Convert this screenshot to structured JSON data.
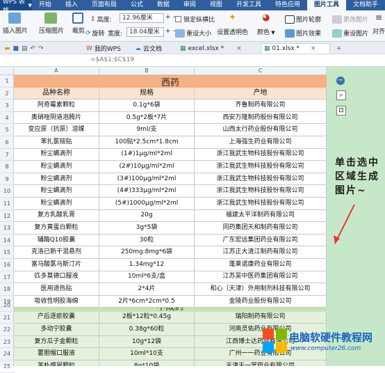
{
  "app": {
    "title": "WPS 表格"
  },
  "ribbon_tabs": [
    "开始",
    "插入",
    "页面布局",
    "公式",
    "数据",
    "审阅",
    "视图",
    "开发工具",
    "特色应用",
    "图片工具",
    "文档助手"
  ],
  "active_tab": "图片工具",
  "ribbon": {
    "insert_picture": "插入图片",
    "compress_picture": "压缩图片",
    "crop": "裁剪",
    "rotate": "旋转",
    "height_label": "高度:",
    "height_value": "12.96厘米",
    "width_label": "宽度:",
    "width_value": "18.04厘米",
    "lock_ratio": "锁定纵横比",
    "reset_size": "重设大小",
    "set_transparent": "设置透明色",
    "color": "颜色",
    "picture_outline": "图片轮廓",
    "picture_effect": "图片效果",
    "change_picture": "更改图片",
    "reset_picture": "重设图片",
    "align": "对齐"
  },
  "doc_tabs": [
    "我的WPS",
    "云文档",
    "excel.xlsx *",
    "01.xlsx *"
  ],
  "active_doc": "01.xlsx *",
  "formula_bar": {
    "formula": "=$A$1:$C$19"
  },
  "columns": [
    "A",
    "B",
    "C"
  ],
  "rows": [
    "1",
    "2",
    "3",
    "4",
    "5",
    "6",
    "7",
    "8",
    "9",
    "10",
    "11",
    "12",
    "13",
    "14",
    "15",
    "16",
    "17",
    "18",
    "19",
    "20",
    "21",
    "22",
    "23",
    "24",
    "25"
  ],
  "section1": {
    "title": "西药",
    "header": [
      "品种名称",
      "规格",
      "产地"
    ]
  },
  "table1": [
    [
      "阿奇霉素颗粒",
      "0.1g*6袋",
      "齐鲁制药有限公司"
    ],
    [
      "奥硝唑阴道泡腾片",
      "0.5g*2板*7片",
      "西安万隆制药股份有限公司"
    ],
    [
      "变应原（抗原）溶媒",
      "9ml/支",
      "山西太行药业股份有限公司"
    ],
    [
      "苯扎氯铵贴",
      "100贴*2.5cm*1.8cm",
      "上海强生药业有限公司"
    ],
    [
      "粉尘螨滴剂",
      "(1#)1μg/ml*2ml",
      "浙江我武生物科技股份有限公司"
    ],
    [
      "粉尘螨滴剂",
      "(2#)10μg/ml*2ml",
      "浙江我武生物科技股份有限公司"
    ],
    [
      "粉尘螨滴剂",
      "(3#)100μg/ml*2ml",
      "浙江我武生物科技股份有限公司"
    ],
    [
      "粉尘螨滴剂",
      "(4#)333μg/ml*2ml",
      "浙江我武生物科技股份有限公司"
    ],
    [
      "粉尘螨滴剂",
      "(5#)1000μg/ml*2ml",
      "浙江我武生物科技股份有限公司"
    ],
    [
      "复方乳酸乳膏",
      "20g",
      "福建太平洋制药有限公司"
    ],
    [
      "复方黄蛋白颗粒",
      "3g*5袋",
      "同药集团天和制药有限公司"
    ],
    [
      "辅酶Q10胶囊",
      "30粒",
      "广东宏远集团药业有限公司"
    ],
    [
      "克洛已新干混悬剂",
      "250mg:8mg*6袋",
      "江苏正大清江制药有限公司"
    ],
    [
      "富马酸氯马斯汀片",
      "1.34mg*12",
      "蓬莱诺康药业有限公司"
    ],
    [
      "匹多莫德口服液",
      "10ml*6支/盒",
      "江苏吴中医药集团有限公司"
    ],
    [
      "医用退热贴",
      "2*4片",
      "和心（天津）外用制剂科技有限公司"
    ],
    [
      "吸收性明胶海绵",
      "2片*6cm*2cm*0.5",
      "金陵药业股份有限公司"
    ]
  ],
  "section2": {
    "title": "中成药"
  },
  "table2": [
    [
      "产后逐瘀胶囊",
      "2板*12粒*0.45g",
      "瑞阳制药有限公司"
    ],
    [
      "多动宁胶囊",
      "0.38g*60粒",
      "河南灵佑药业有限公司"
    ],
    [
      "复方瓜子金颗粒",
      "10g*12袋",
      "江西博士达药业有限公司"
    ],
    [
      "藿胆帽口服液",
      "10ml*10支",
      "广州一一药业有限公司"
    ],
    [
      "芙朴感冒颗粒",
      "8g*10袋",
      "天津天一堂药业有限公司"
    ]
  ],
  "annotation": "单击选中区域生成图片~",
  "watermark": {
    "title": "电脑软硬件教程网",
    "url": "www.computer26.com"
  }
}
